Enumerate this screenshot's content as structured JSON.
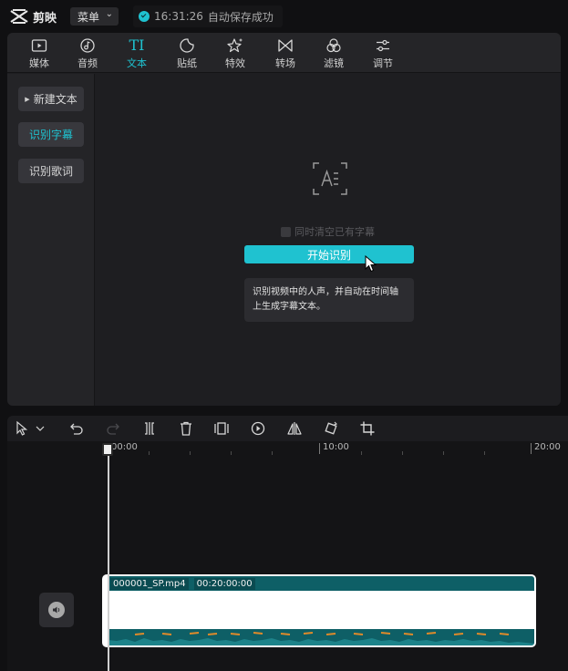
{
  "app": {
    "title": "剪映"
  },
  "menu": {
    "label": "菜单"
  },
  "save_status": {
    "time": "16:31:26",
    "text": "自动保存成功"
  },
  "toolbar": {
    "items": [
      {
        "label": "媒体",
        "icon": "media-icon"
      },
      {
        "label": "音频",
        "icon": "audio-icon"
      },
      {
        "label": "文本",
        "icon": "text-icon",
        "active": true
      },
      {
        "label": "贴纸",
        "icon": "sticker-icon"
      },
      {
        "label": "特效",
        "icon": "effects-icon"
      },
      {
        "label": "转场",
        "icon": "transition-icon"
      },
      {
        "label": "滤镜",
        "icon": "filter-icon"
      },
      {
        "label": "调节",
        "icon": "adjust-icon"
      }
    ],
    "text_icon_glyph": "TI"
  },
  "sidebar": {
    "items": [
      {
        "label": "新建文本"
      },
      {
        "label": "识别字幕",
        "active": true
      },
      {
        "label": "识别歌词"
      }
    ]
  },
  "recognition": {
    "checkbox_label": "同时清空已有字幕",
    "start_button": "开始识别",
    "tooltip": "识别视频中的人声，并自动在时间轴上生成字幕文本。"
  },
  "timeline": {
    "ruler": {
      "labels": [
        "00:00",
        "10:00",
        "20:00"
      ]
    },
    "clip": {
      "filename": "000001_SP.mp4",
      "duration": "00:20:00:00"
    }
  },
  "colors": {
    "accent": "#1fc2d0",
    "clip_header": "#0e5f66",
    "waveform": "#e08a2a"
  }
}
